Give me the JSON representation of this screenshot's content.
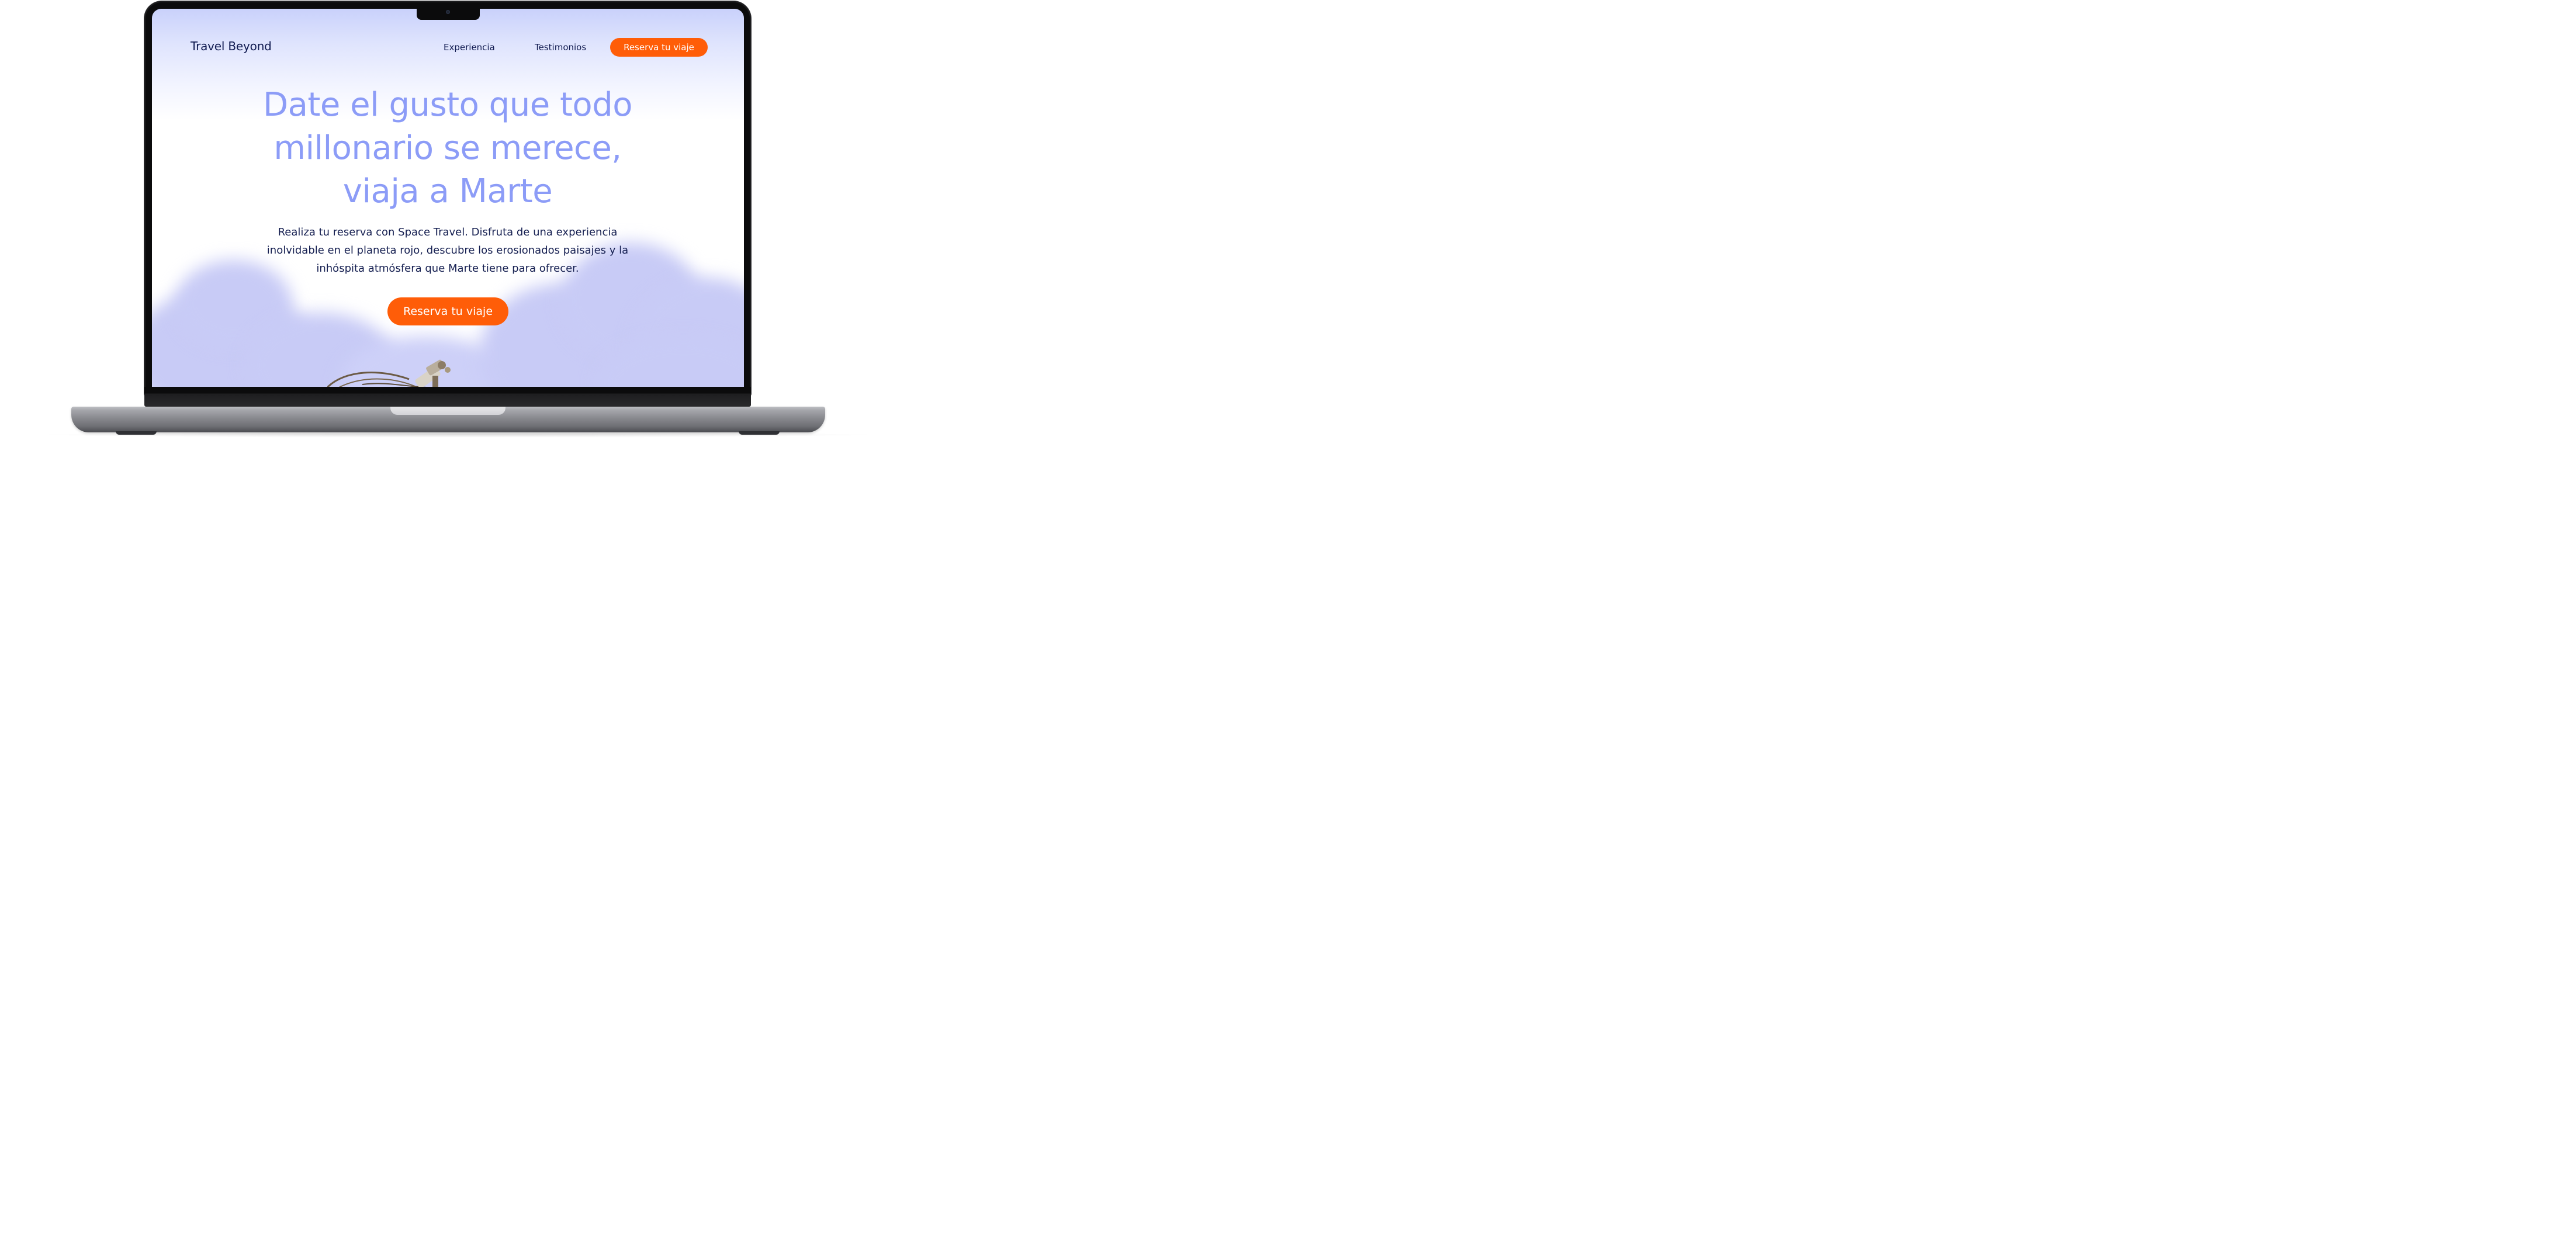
{
  "site": {
    "logo": "Travel Beyond",
    "nav": {
      "items": [
        {
          "label": "Experiencia"
        },
        {
          "label": "Testimonios"
        }
      ],
      "cta_label": "Reserva tu viaje"
    }
  },
  "hero": {
    "title_lines": [
      "Date el gusto que todo",
      "millonario se merece,",
      "viaja a Marte"
    ],
    "description_lines": [
      "Realiza tu reserva con Space Travel. Disfruta de una experiencia",
      "inolvidable en el planeta rojo, descubre los erosionados paisajes y la",
      "inhóspita atmósfera que Marte tiene para ofrecer."
    ],
    "cta_label": "Reserva tu viaje"
  },
  "colors": {
    "accent": "#ff5d08",
    "title": "#8c9cf7",
    "text": "#101a50",
    "sky_top": "#c9d1fb",
    "cloud": "#c8cbf6"
  },
  "icons": {
    "camera": "camera-icon",
    "satellite": "satellite-illustration"
  }
}
